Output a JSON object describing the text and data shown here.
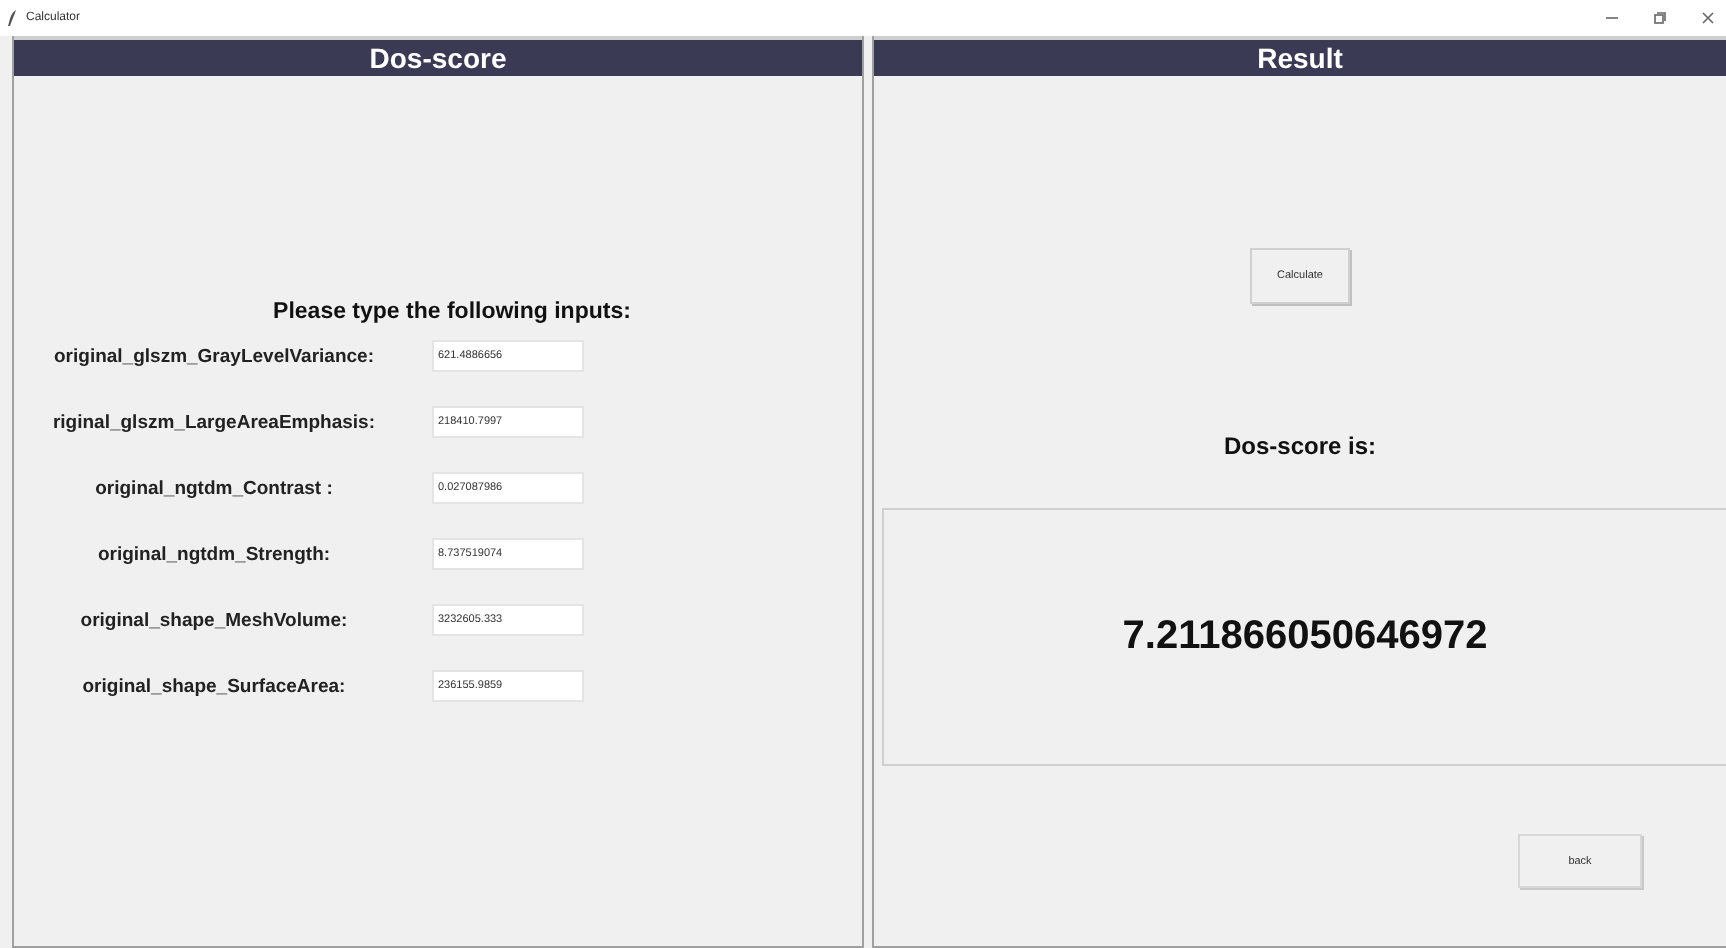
{
  "window": {
    "title": "Calculator"
  },
  "input_panel": {
    "header": "Dos-score",
    "prompt": "Please type the following inputs:",
    "fields": [
      {
        "label": "original_glszm_GrayLevelVariance:",
        "value": "621.4886656"
      },
      {
        "label": "riginal_glszm_LargeAreaEmphasis:",
        "value": "218410.7997"
      },
      {
        "label": "original_ngtdm_Contrast :",
        "value": "0.027087986"
      },
      {
        "label": "original_ngtdm_Strength:",
        "value": "8.737519074"
      },
      {
        "label": "original_shape_MeshVolume:",
        "value": "3232605.333"
      },
      {
        "label": "original_shape_SurfaceArea:",
        "value": "236155.9859"
      }
    ]
  },
  "result_panel": {
    "header": "Result",
    "calculate_button": "Calculate",
    "result_label": "Dos-score is:",
    "result_value": "7.211866050646972",
    "back_button": "back"
  }
}
